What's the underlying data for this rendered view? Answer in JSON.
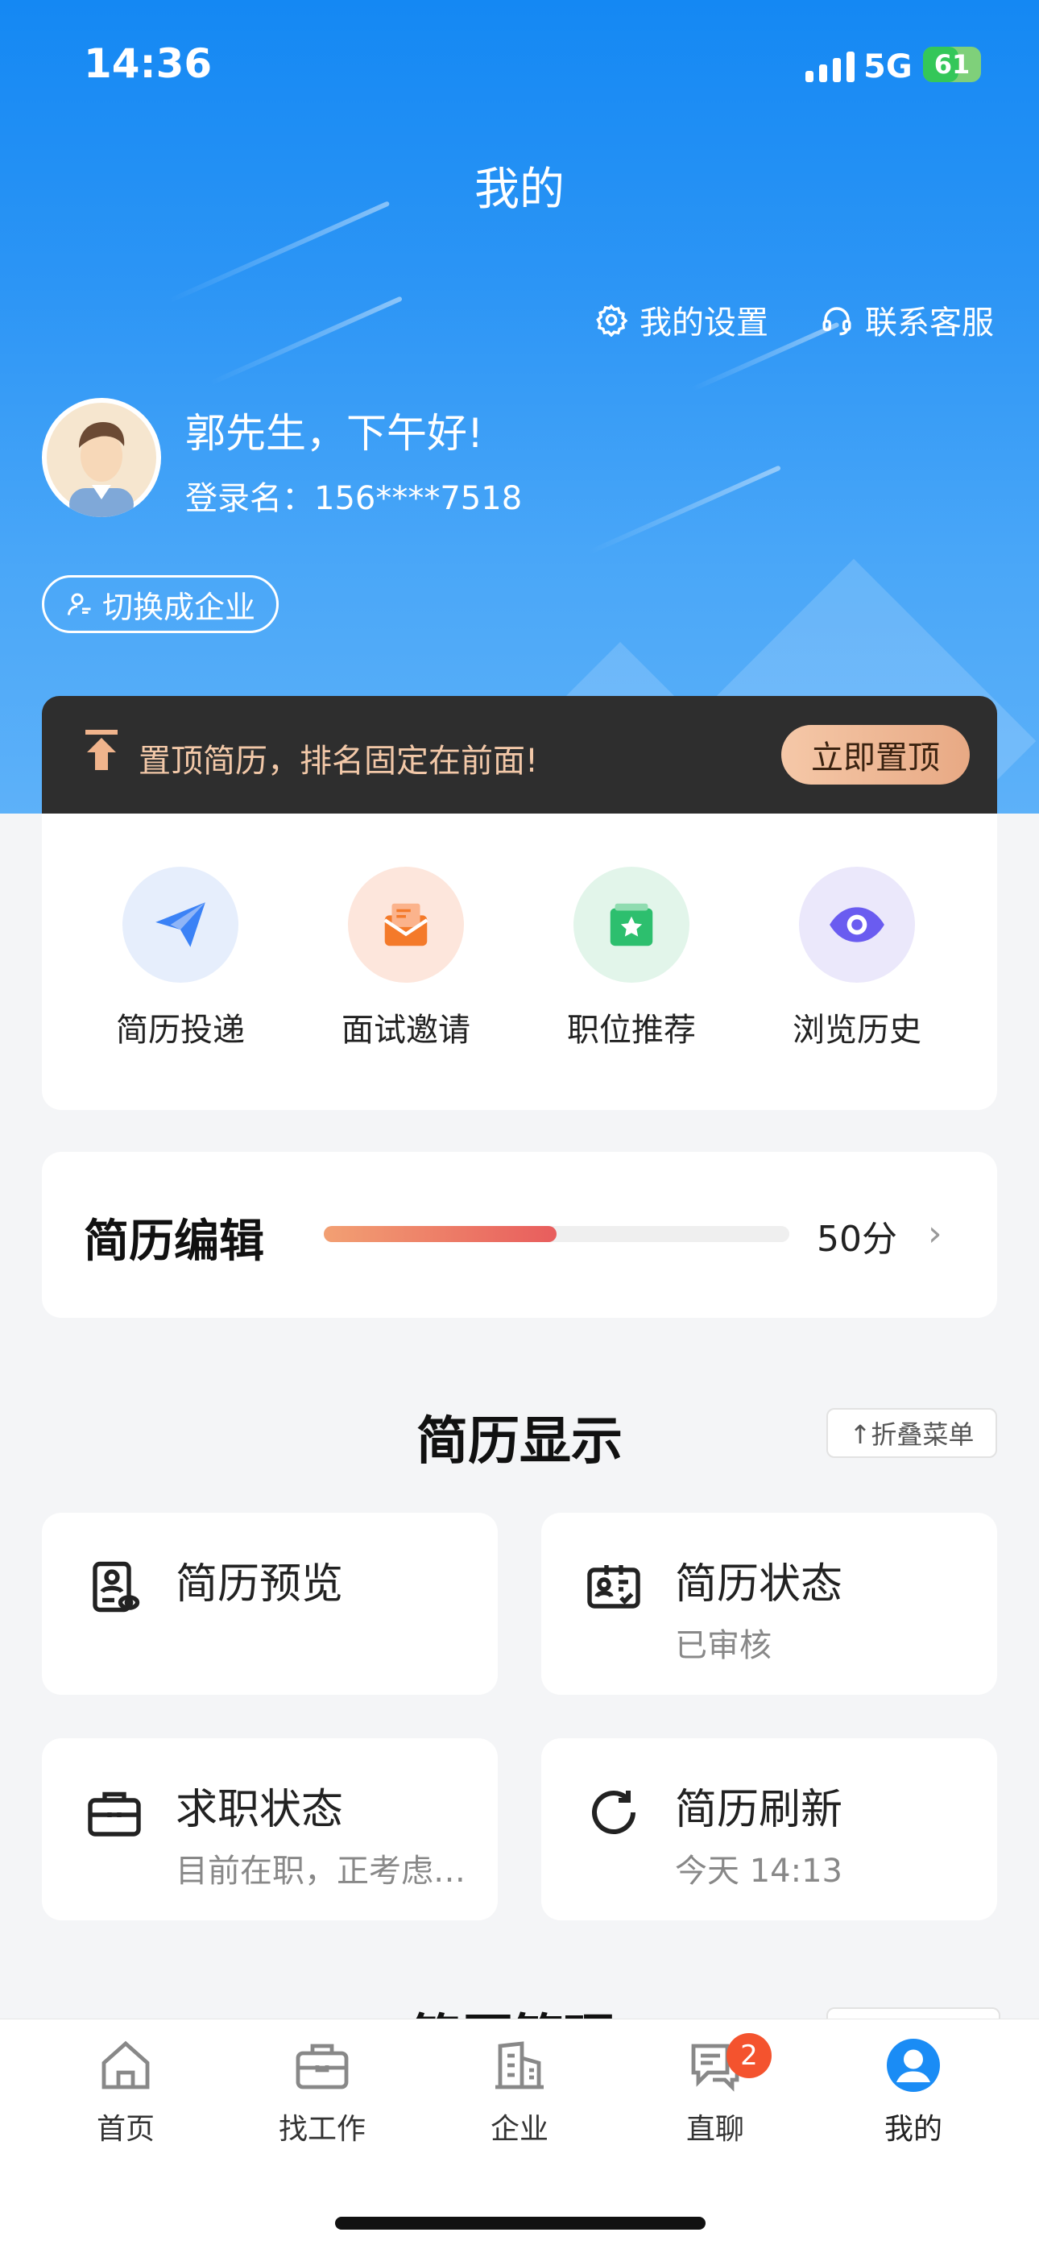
{
  "status_bar": {
    "time": "14:36",
    "network": "5G",
    "battery_level": "61",
    "battery_fraction": 0.61
  },
  "nav": {
    "title": "我的"
  },
  "header": {
    "settings_label": "我的设置",
    "service_label": "联系客服",
    "greeting": "郭先生，下午好!",
    "login_name": "登录名：156****7518",
    "switch_label": "切换成企业"
  },
  "promo": {
    "text": "置顶简历，排名固定在前面!",
    "button": "立即置顶"
  },
  "quick_actions": [
    {
      "label": "简历投递",
      "icon": "paper-plane-icon",
      "color": "#3b82f6",
      "bg": "#e6eefc"
    },
    {
      "label": "面试邀请",
      "icon": "envelope-icon",
      "color": "#f47a2a",
      "bg": "#fde6dc"
    },
    {
      "label": "职位推荐",
      "icon": "star-folder-icon",
      "color": "#2dbf6e",
      "bg": "#e2f5ea"
    },
    {
      "label": "浏览历史",
      "icon": "eye-icon",
      "color": "#6a5cf0",
      "bg": "#ebe8fb"
    }
  ],
  "resume_edit": {
    "title": "简历编辑",
    "score": "50分",
    "progress": 0.5
  },
  "resume_display": {
    "title": "简历显示",
    "fold_label": "↑折叠菜单",
    "tiles": [
      {
        "title": "简历预览",
        "subtitle": "",
        "icon": "resume-preview-icon"
      },
      {
        "title": "简历状态",
        "subtitle": "已审核",
        "icon": "id-card-check-icon"
      },
      {
        "title": "求职状态",
        "subtitle": "目前在职，正考虑…",
        "icon": "briefcase-icon"
      },
      {
        "title": "简历刷新",
        "subtitle": "今天 14:13",
        "icon": "refresh-icon"
      }
    ]
  },
  "next_section": {
    "title": "简历管理"
  },
  "tabbar": {
    "items": [
      {
        "label": "首页",
        "icon": "home-icon"
      },
      {
        "label": "找工作",
        "icon": "briefcase-icon"
      },
      {
        "label": "企业",
        "icon": "building-icon"
      },
      {
        "label": "直聊",
        "icon": "chat-icon"
      },
      {
        "label": "我的",
        "icon": "user-icon"
      }
    ],
    "chat_badge": "2",
    "active_color": "#1a8cf5"
  }
}
